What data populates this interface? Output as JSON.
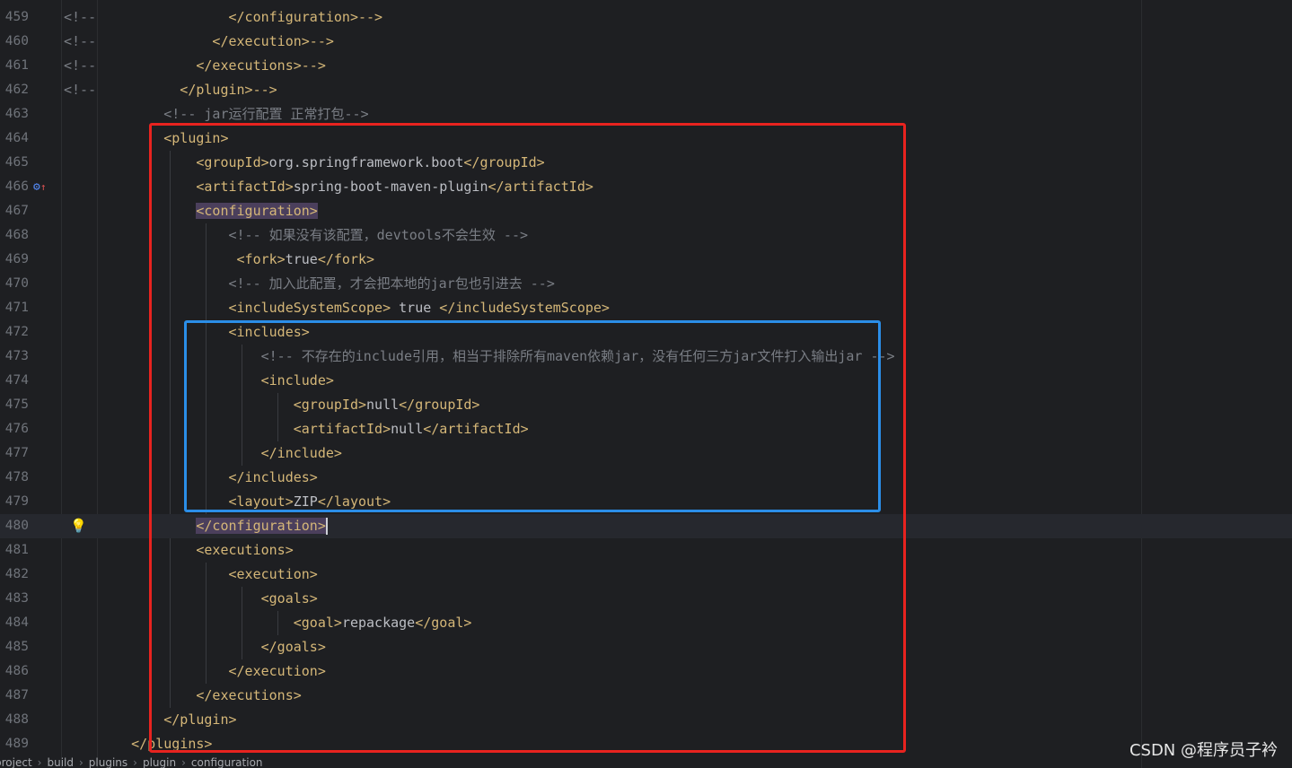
{
  "lines": [
    {
      "num": "459",
      "gutter": "<!--",
      "code": [
        {
          "t": "tag",
          "v": "                </configuration>-->"
        }
      ]
    },
    {
      "num": "460",
      "gutter": "<!--",
      "code": [
        {
          "t": "tag",
          "v": "              </execution>-->"
        }
      ]
    },
    {
      "num": "461",
      "gutter": "<!--",
      "code": [
        {
          "t": "tag",
          "v": "            </executions>-->"
        }
      ]
    },
    {
      "num": "462",
      "gutter": "<!--",
      "code": [
        {
          "t": "tag",
          "v": "          </plugin>-->"
        }
      ]
    },
    {
      "num": "463",
      "code": [
        {
          "t": "cmt",
          "v": "        <!-- jar运行配置 正常打包-->"
        }
      ]
    },
    {
      "num": "464",
      "code": [
        {
          "t": "tag",
          "v": "        <plugin>"
        }
      ]
    },
    {
      "num": "465",
      "code": [
        {
          "t": "tag",
          "v": "            <groupId>"
        },
        {
          "t": "txt",
          "v": "org.springframework.boot"
        },
        {
          "t": "tag",
          "v": "</groupId>"
        }
      ]
    },
    {
      "num": "466",
      "icon": "run-config-icon",
      "code": [
        {
          "t": "tag",
          "v": "            <artifactId>"
        },
        {
          "t": "txt",
          "v": "spring-boot-maven-plugin"
        },
        {
          "t": "tag",
          "v": "</artifactId>"
        }
      ]
    },
    {
      "num": "467",
      "code": [
        {
          "t": "tag",
          "v": "            "
        },
        {
          "t": "taghl",
          "v": "<configuration>"
        }
      ]
    },
    {
      "num": "468",
      "code": [
        {
          "t": "cmt",
          "v": "                <!-- 如果没有该配置，devtools不会生效 -->"
        }
      ]
    },
    {
      "num": "469",
      "code": [
        {
          "t": "tag",
          "v": "                 <fork>"
        },
        {
          "t": "txt",
          "v": "true"
        },
        {
          "t": "tag",
          "v": "</fork>"
        }
      ]
    },
    {
      "num": "470",
      "code": [
        {
          "t": "cmt",
          "v": "                <!-- 加入此配置，才会把本地的jar包也引进去 -->"
        }
      ]
    },
    {
      "num": "471",
      "code": [
        {
          "t": "tag",
          "v": "                <includeSystemScope>"
        },
        {
          "t": "txt",
          "v": " true "
        },
        {
          "t": "tag",
          "v": "</includeSystemScope>"
        }
      ]
    },
    {
      "num": "472",
      "code": [
        {
          "t": "tag",
          "v": "                <includes>"
        }
      ]
    },
    {
      "num": "473",
      "code": [
        {
          "t": "cmt",
          "v": "                    <!-- 不存在的include引用，相当于排除所有maven依赖jar，没有任何三方jar文件打入输出jar -->"
        }
      ]
    },
    {
      "num": "474",
      "code": [
        {
          "t": "tag",
          "v": "                    <include>"
        }
      ]
    },
    {
      "num": "475",
      "code": [
        {
          "t": "tag",
          "v": "                        <groupId>"
        },
        {
          "t": "txt",
          "v": "null"
        },
        {
          "t": "tag",
          "v": "</groupId>"
        }
      ]
    },
    {
      "num": "476",
      "code": [
        {
          "t": "tag",
          "v": "                        <artifactId>"
        },
        {
          "t": "txt",
          "v": "null"
        },
        {
          "t": "tag",
          "v": "</artifactId>"
        }
      ]
    },
    {
      "num": "477",
      "code": [
        {
          "t": "tag",
          "v": "                    </include>"
        }
      ]
    },
    {
      "num": "478",
      "code": [
        {
          "t": "tag",
          "v": "                </includes>"
        }
      ]
    },
    {
      "num": "479",
      "code": [
        {
          "t": "tag",
          "v": "                <layout>"
        },
        {
          "t": "txt",
          "v": "ZIP"
        },
        {
          "t": "tag",
          "v": "</layout>"
        }
      ]
    },
    {
      "num": "480",
      "current": true,
      "bulb": true,
      "code": [
        {
          "t": "tag",
          "v": "            "
        },
        {
          "t": "taghl",
          "v": "</configuration>"
        },
        {
          "t": "caret",
          "v": ""
        }
      ]
    },
    {
      "num": "481",
      "code": [
        {
          "t": "tag",
          "v": "            <executions>"
        }
      ]
    },
    {
      "num": "482",
      "code": [
        {
          "t": "tag",
          "v": "                <execution>"
        }
      ]
    },
    {
      "num": "483",
      "code": [
        {
          "t": "tag",
          "v": "                    <goals>"
        }
      ]
    },
    {
      "num": "484",
      "code": [
        {
          "t": "tag",
          "v": "                        <goal>"
        },
        {
          "t": "txt",
          "v": "repackage"
        },
        {
          "t": "tag",
          "v": "</goal>"
        }
      ]
    },
    {
      "num": "485",
      "code": [
        {
          "t": "tag",
          "v": "                    </goals>"
        }
      ]
    },
    {
      "num": "486",
      "code": [
        {
          "t": "tag",
          "v": "                </execution>"
        }
      ]
    },
    {
      "num": "487",
      "code": [
        {
          "t": "tag",
          "v": "            </executions>"
        }
      ]
    },
    {
      "num": "488",
      "code": [
        {
          "t": "tag",
          "v": "        </plugin>"
        }
      ]
    },
    {
      "num": "489",
      "code": [
        {
          "t": "tag",
          "v": "    </plugins>"
        }
      ]
    }
  ],
  "breadcrumb": [
    "project",
    "build",
    "plugins",
    "plugin",
    "configuration"
  ],
  "watermark": "CSDN @程序员子衿",
  "colors": {
    "background": "#1e1f22",
    "tag": "#d5b778",
    "text": "#bcbec4",
    "comment": "#7a7e85",
    "red_box": "#e8231f",
    "blue_box": "#2b8ee8"
  }
}
